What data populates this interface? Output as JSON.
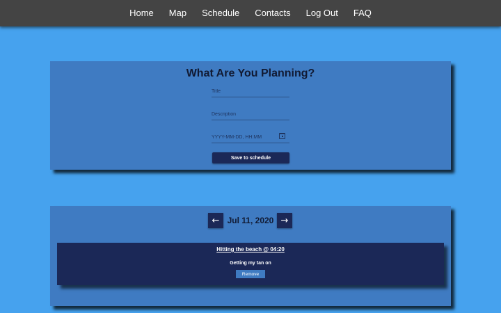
{
  "nav": {
    "items": [
      {
        "label": "Home"
      },
      {
        "label": "Map"
      },
      {
        "label": "Schedule"
      },
      {
        "label": "Contacts"
      },
      {
        "label": "Log Out"
      },
      {
        "label": "FAQ"
      }
    ]
  },
  "planner": {
    "heading": "What Are You Planning?",
    "title_placeholder": "Title",
    "description_placeholder": "Description",
    "datetime_placeholder": "YYYY-MM-DD, HH:MM",
    "save_label": "Save to schedule"
  },
  "schedule": {
    "prev_icon": "arrow-left-icon",
    "prev_glyph": "←",
    "next_icon": "arrow-right-icon",
    "next_glyph": "→",
    "date": "Jul 11, 2020",
    "events": [
      {
        "title": "Hitting the beach @ 04:20",
        "description": "Getting my tan on",
        "remove_label": "Remove"
      }
    ]
  },
  "colors": {
    "background": "#46a2ee",
    "nav_bar": "#444444",
    "card": "#3f7bc2",
    "dark_accent": "#1b2857"
  }
}
